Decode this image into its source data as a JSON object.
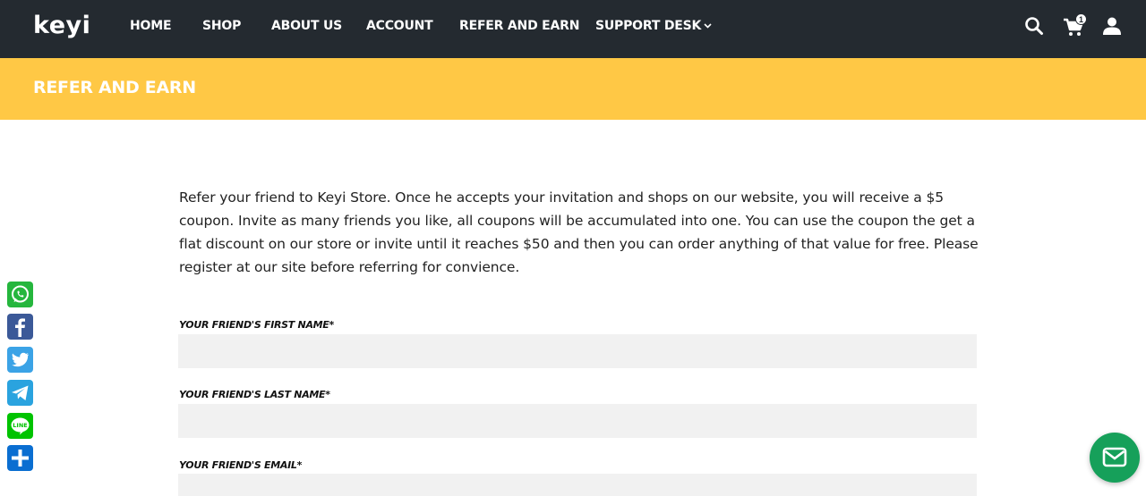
{
  "header": {
    "logo": "keyi",
    "nav": [
      {
        "label": "HOME"
      },
      {
        "label": "SHOP"
      },
      {
        "label": "ABOUT US"
      },
      {
        "label": "ACCOUNT"
      },
      {
        "label": "REFER AND EARN"
      },
      {
        "label": "SUPPORT DESK"
      }
    ],
    "cart_count": "1",
    "icons": [
      "search-icon",
      "cart-icon",
      "user-icon",
      "chevron-down-icon"
    ]
  },
  "banner": {
    "title": "REFER AND EARN",
    "color": "#ffc845"
  },
  "main": {
    "intro": "Refer your friend to Keyi Store. Once he accepts your invitation and shops on our website, you will receive a $5 coupon. Invite as many friends you like, all coupons will be accumulated into one. You can use the coupon the get a flat discount on our store or invite until it reaches $50 and then you can order anything of that value for free. Please register at our site before referring for convience.",
    "fields": [
      {
        "label": "YOUR FRIEND'S FIRST NAME*",
        "value": ""
      },
      {
        "label": "YOUR FRIEND'S LAST NAME*",
        "value": ""
      },
      {
        "label": "YOUR FRIEND'S EMAIL*",
        "value": ""
      }
    ]
  },
  "share_bar": {
    "items": [
      {
        "name": "whatsapp-icon",
        "color": "#25b63d"
      },
      {
        "name": "facebook-icon",
        "color": "#3b5998"
      },
      {
        "name": "twitter-icon",
        "color": "#3ba3e6"
      },
      {
        "name": "telegram-icon",
        "color": "#2aa3df"
      },
      {
        "name": "line-icon",
        "color": "#00c300"
      },
      {
        "name": "share-plus-icon",
        "color": "#0a6ed1"
      }
    ]
  },
  "floating": {
    "mail_icon": "mail-icon",
    "color": "#16a05a"
  },
  "colors": {
    "header_bg": "#242a30",
    "banner_bg": "#ffc845",
    "input_bg": "#f1f1f1"
  }
}
